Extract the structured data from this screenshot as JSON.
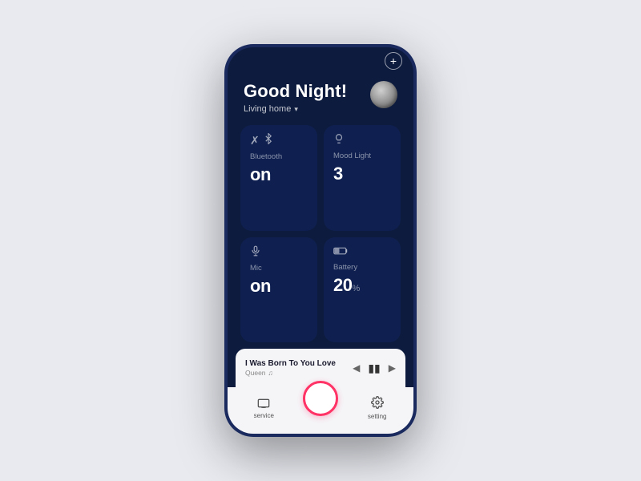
{
  "phone": {
    "add_button_label": "+",
    "header": {
      "greeting": "Good Night!",
      "location": "Living home",
      "location_chevron": "▾"
    },
    "cards": [
      {
        "id": "bluetooth",
        "icon": "bluetooth",
        "label": "Bluetooth",
        "value": "on",
        "unit": ""
      },
      {
        "id": "mood_light",
        "icon": "bulb",
        "label": "Mood Light",
        "value": "3",
        "unit": ""
      },
      {
        "id": "mic",
        "icon": "mic",
        "label": "Mic",
        "value": "on",
        "unit": ""
      },
      {
        "id": "battery",
        "icon": "battery",
        "label": "Battery",
        "value": "20",
        "unit": "%"
      }
    ],
    "music": {
      "title": "I Was Born To You Love",
      "artist": "Queen",
      "artist_icon": "♫"
    },
    "nav": {
      "service_label": "service",
      "setting_label": "setting"
    }
  }
}
